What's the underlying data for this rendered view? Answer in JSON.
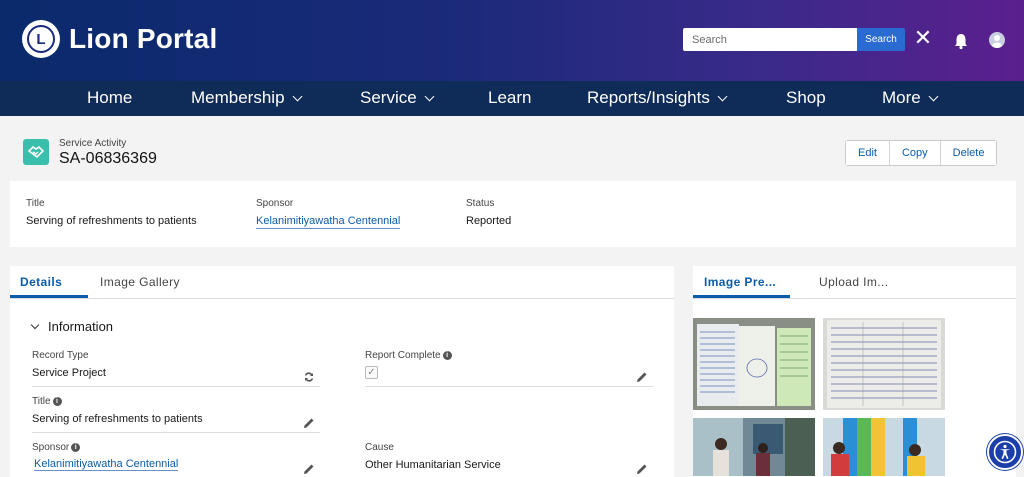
{
  "header": {
    "brand": "Lion Portal",
    "search_placeholder": "Search",
    "search_button": "Search"
  },
  "nav": {
    "items": [
      {
        "label": "Home",
        "dropdown": false
      },
      {
        "label": "Membership",
        "dropdown": true
      },
      {
        "label": "Service",
        "dropdown": true
      },
      {
        "label": "Learn",
        "dropdown": false
      },
      {
        "label": "Reports/Insights",
        "dropdown": true
      },
      {
        "label": "Shop",
        "dropdown": false
      },
      {
        "label": "More",
        "dropdown": true
      }
    ]
  },
  "record": {
    "type_label": "Service Activity",
    "number": "SA-06836369",
    "actions": {
      "edit": "Edit",
      "copy": "Copy",
      "delete": "Delete"
    }
  },
  "highlights": {
    "title_label": "Title",
    "title_value": "Serving of refreshments to patients",
    "sponsor_label": "Sponsor",
    "sponsor_value": "Kelanimitiyawatha Centennial",
    "status_label": "Status",
    "status_value": "Reported"
  },
  "tabs": {
    "details": "Details",
    "gallery": "Image Gallery"
  },
  "details": {
    "section_title": "Information",
    "record_type_label": "Record Type",
    "record_type_value": "Service Project",
    "report_complete_label": "Report Complete",
    "title_label": "Title",
    "title_value": "Serving of refreshments to patients",
    "sponsor_label": "Sponsor",
    "sponsor_value": "Kelanimitiyawatha Centennial",
    "cause_label": "Cause",
    "cause_value": "Other Humanitarian Service"
  },
  "side_tabs": {
    "preview": "Image Pre...",
    "upload": "Upload Im..."
  },
  "colors": {
    "brand_blue": "#0f2b57",
    "accent": "#0b5cab",
    "record_icon": "#3bbfad"
  }
}
